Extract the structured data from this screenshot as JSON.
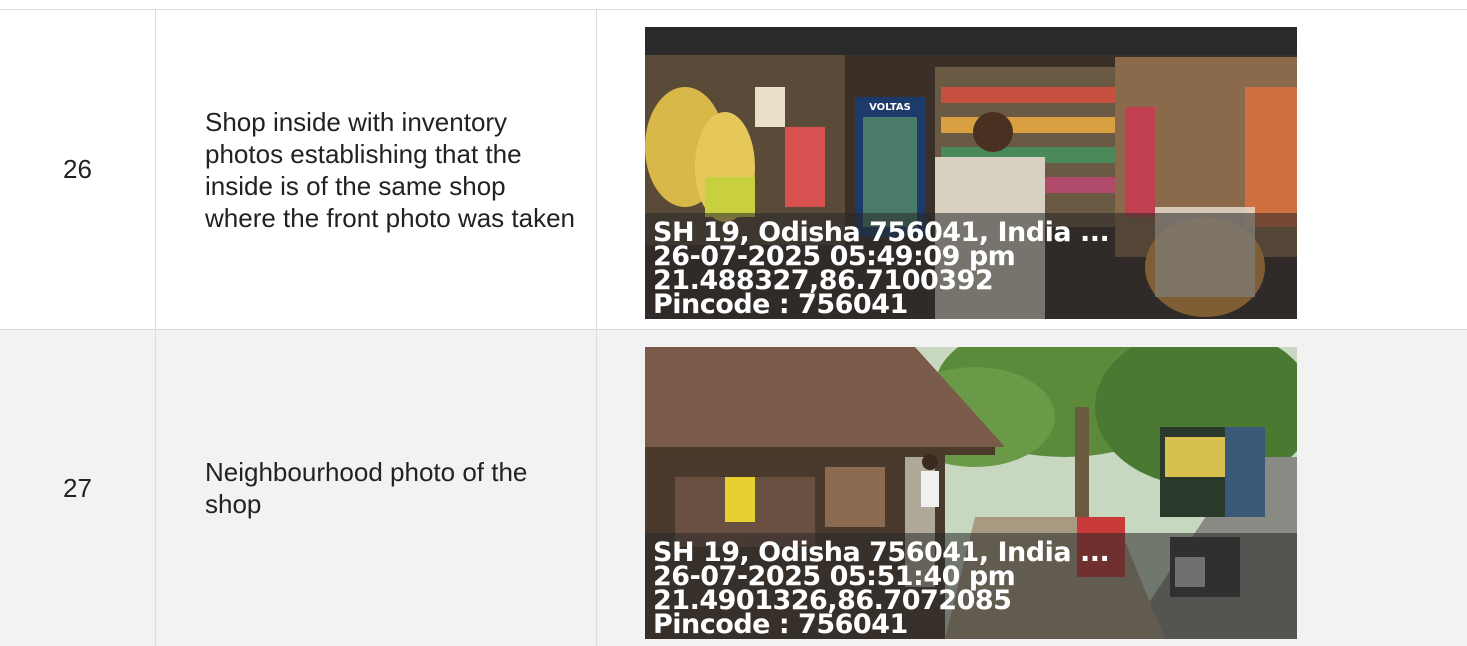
{
  "rows": [
    {
      "number": "26",
      "description": "Shop inside with inventory photos establishing that the inside is of the same shop where the front photo was taken",
      "photo": {
        "address": "SH 19, Odisha 756041, India ...",
        "datetime": "26-07-2025 05:49:09 pm",
        "coords": "21.488327,86.7100392",
        "pincode": "Pincode : 756041",
        "fridge_brand": "VOLTAS"
      }
    },
    {
      "number": "27",
      "description": "Neighbourhood photo of the shop",
      "photo": {
        "address": "SH 19, Odisha 756041, India ...",
        "datetime": "26-07-2025 05:51:40 pm",
        "coords": "21.4901326,86.7072085",
        "pincode": "Pincode : 756041"
      }
    }
  ]
}
